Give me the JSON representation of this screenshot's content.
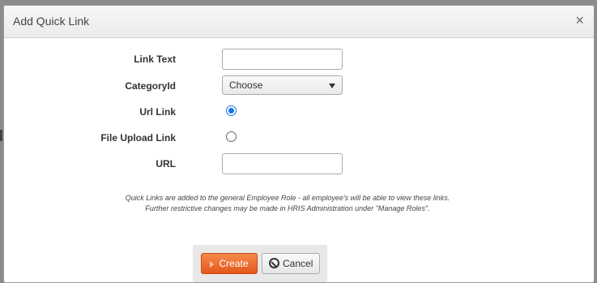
{
  "dialog": {
    "title": "Add Quick Link",
    "close_symbol": "×"
  },
  "form": {
    "link_text": {
      "label": "Link Text",
      "value": ""
    },
    "category": {
      "label": "CategoryId",
      "selected": "Choose"
    },
    "url_link": {
      "label": "Url Link",
      "checked": true
    },
    "file_upload": {
      "label": "File Upload Link",
      "checked": false
    },
    "url": {
      "label": "URL",
      "value": ""
    }
  },
  "note": {
    "line1": "Quick Links are added to the general Employee Role - all employee's will be able to view these links.",
    "line2": "Further restrictive changes may be made in HRIS Administration under \"Manage Roles\"."
  },
  "buttons": {
    "create": "Create",
    "cancel": "Cancel"
  }
}
